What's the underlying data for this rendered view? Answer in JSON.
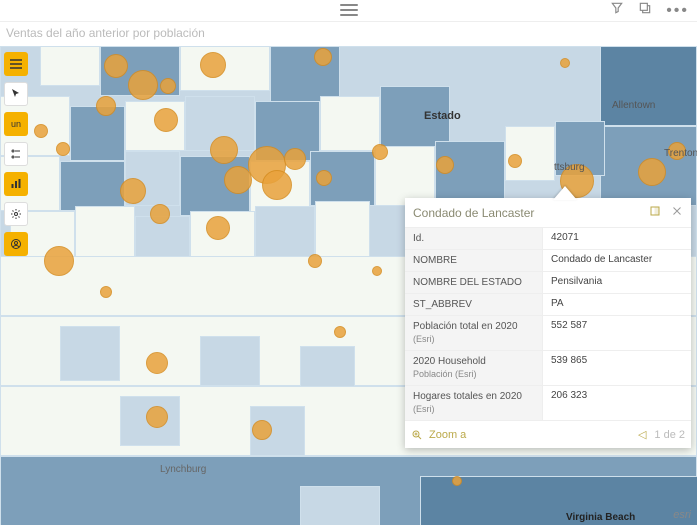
{
  "header": {
    "title": "Ventas del año anterior por población"
  },
  "state_label": "Estado",
  "toolbar": {
    "menu": "≡",
    "select": "↖",
    "un_label": "un",
    "category": "⦿",
    "chart": "▥",
    "settings": "⚙",
    "user": "◉"
  },
  "popup": {
    "title": "Condado de Lancaster",
    "rows": [
      {
        "k": "Id.",
        "sub": "",
        "v": "42071"
      },
      {
        "k": "NOMBRE",
        "sub": "",
        "v": "Condado de Lancaster"
      },
      {
        "k": "NOMBRE DEL ESTADO",
        "sub": "",
        "v": "Pensilvania"
      },
      {
        "k": "ST_ABBREV",
        "sub": "",
        "v": "PA"
      },
      {
        "k": "Población total en 2020",
        "sub": "(Esri)",
        "v": "552 587"
      },
      {
        "k": "2020 Household",
        "sub": "Población (Esri)",
        "v": "539 865"
      },
      {
        "k": "Hogares totales en 2020",
        "sub": "(Esri)",
        "v": "206 323"
      }
    ],
    "zoom_label": "Zoom a",
    "pager_text": "1 de 2"
  },
  "map_labels": {
    "virginia_beach": "Virginia Beach",
    "allentown": "Allentown",
    "trenton": "Trenton",
    "pittsburg": "ttsburg",
    "lynchburg": "Lynchburg"
  },
  "attribution": "esri"
}
